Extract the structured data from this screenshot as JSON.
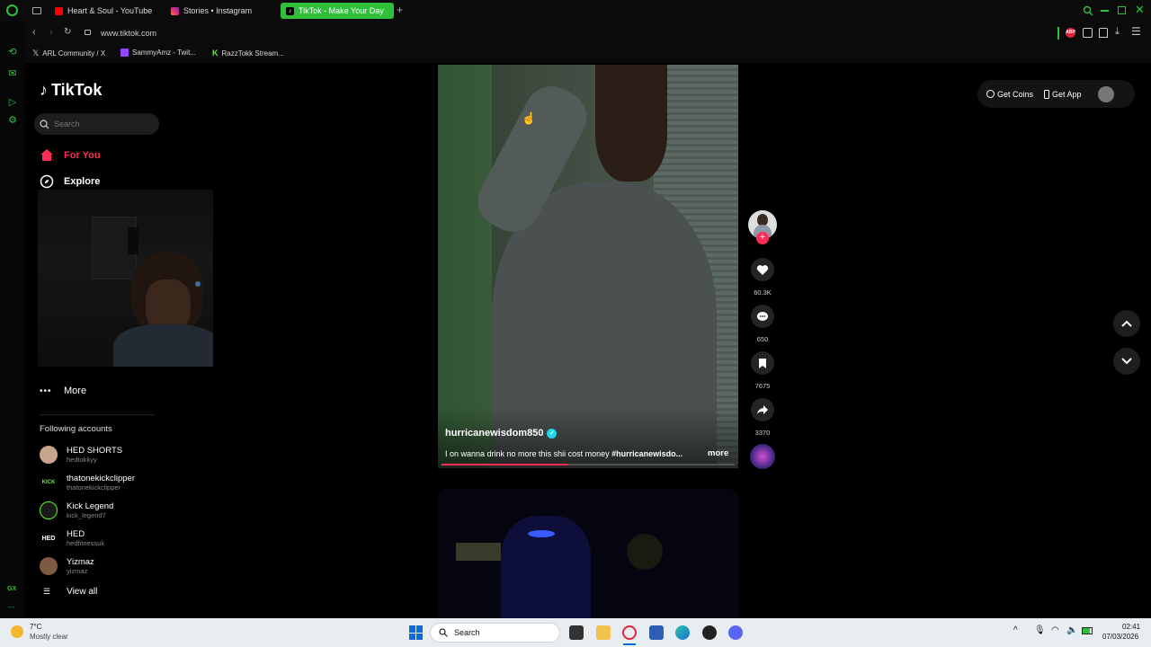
{
  "browser": {
    "tabs": [
      {
        "label": "Heart & Soul - YouTube",
        "icon": "youtube-icon",
        "color": "#ff0000"
      },
      {
        "label": "Stories • Instagram",
        "icon": "instagram-icon",
        "color": "#e1306c"
      },
      {
        "label": "TikTok - Make Your Day",
        "icon": "tiktok-icon",
        "color": "#000000",
        "active": true
      }
    ],
    "new_tab": "+",
    "url": "www.tiktok.com",
    "bookmarks": [
      {
        "label": "ARL Community / X",
        "icon": "x-icon"
      },
      {
        "label": "SammyAmz - Twit...",
        "icon": "twitch-icon"
      },
      {
        "label": "RazzTokk Stream...",
        "icon": "kick-icon"
      }
    ],
    "accent": "#2fbf3a"
  },
  "tiktok": {
    "logo": "TikTok",
    "search_placeholder": "Search",
    "nav": [
      {
        "label": "For You",
        "icon": "home-icon",
        "active": true
      },
      {
        "label": "Explore",
        "icon": "compass-icon"
      },
      {
        "label": "More",
        "icon": "ellipsis-icon"
      }
    ],
    "following_heading": "Following accounts",
    "accounts": [
      {
        "name": "HED SHORTS",
        "handle": "hedtokkyy",
        "avatar": ""
      },
      {
        "name": "thatonekickclipper",
        "handle": "thatonekickclipper",
        "avatar": "KICK"
      },
      {
        "name": "Kick Legend",
        "handle": "kick_legend7",
        "avatar": ""
      },
      {
        "name": "HED",
        "handle": "hedfitnessuk",
        "avatar": "HED"
      },
      {
        "name": "Yizmaz",
        "handle": "yizmaz",
        "avatar": ""
      }
    ],
    "view_all": "View all",
    "get_coins": "Get Coins",
    "get_app": "Get App",
    "video": {
      "author": "hurricanewisdom850",
      "caption": "I on wanna drink no more this shii cost money ",
      "hashtag": "#hurricanewisdo...",
      "more": "more",
      "likes": "60.3K",
      "comments": "650",
      "saves": "7675",
      "shares": "3370"
    }
  },
  "taskbar": {
    "temperature": "7°C",
    "weather": "Mostly clear",
    "search": "Search",
    "time": "02:41",
    "date": "07/03/2026"
  },
  "rail": {
    "gx": "GX",
    "dots": "..."
  }
}
